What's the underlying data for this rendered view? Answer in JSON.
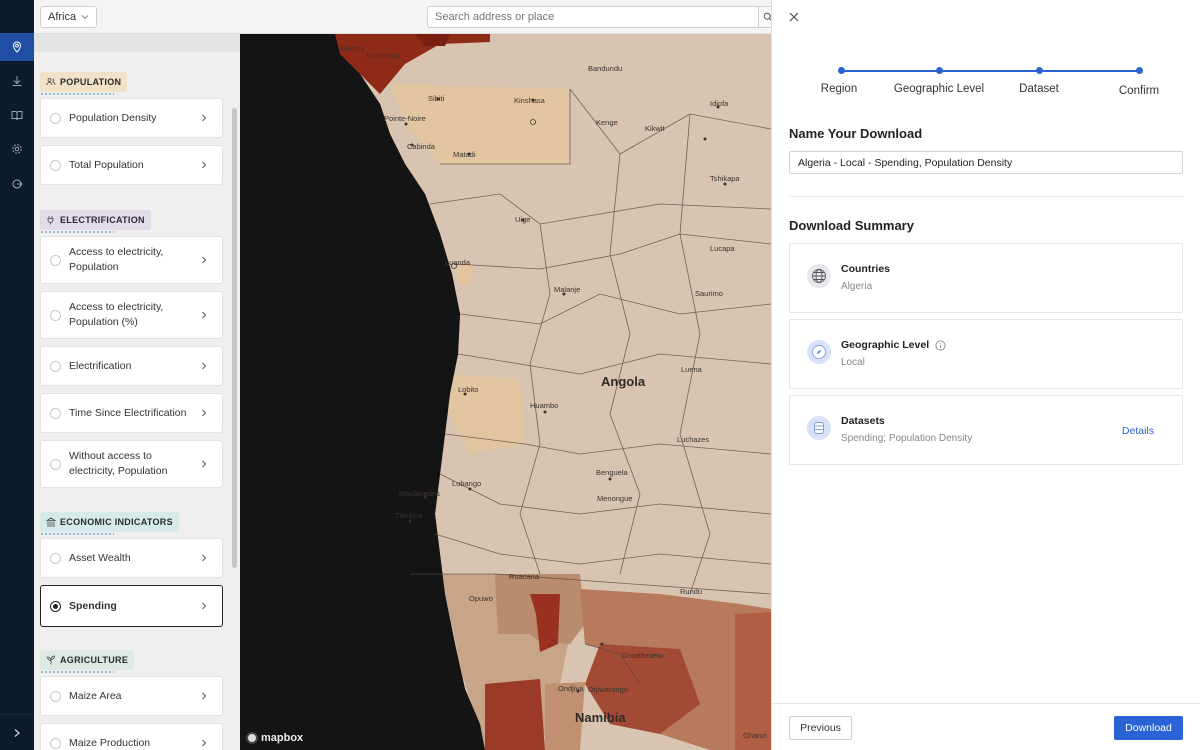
{
  "rail": {
    "items": [
      {
        "icon": "map-pin-icon",
        "active": true
      },
      {
        "icon": "download-icon",
        "active": false
      },
      {
        "icon": "book-icon",
        "active": false
      },
      {
        "icon": "gear-icon",
        "active": false
      },
      {
        "icon": "logout-icon",
        "active": false
      }
    ],
    "expand_icon": "chevron-right-icon"
  },
  "topbar": {
    "region_value": "Africa",
    "search_placeholder": "Search address or place"
  },
  "datasets": {
    "categories": [
      {
        "label": "POPULATION",
        "items": [
          "Population Density",
          "Total Population"
        ]
      },
      {
        "label": "ELECTRIFICATION",
        "items": [
          "Access to electricity, Population",
          "Access to electricity, Population (%)",
          "Electrification",
          "Time Since Electrification",
          "Without access to electricity, Population"
        ]
      },
      {
        "label": "ECONOMIC INDICATORS",
        "items": [
          "Asset Wealth",
          "Spending"
        ]
      },
      {
        "label": "AGRICULTURE",
        "items": [
          "Maize Area",
          "Maize Production"
        ]
      }
    ],
    "selected": "Spending"
  },
  "map": {
    "country_label": "Angola",
    "country_label_2": "Namibia",
    "places": [
      "Gamba",
      "Tchibanga",
      "Bandundu",
      "Sibiti",
      "Kinshasa",
      "Idiofa",
      "Pointe-Noire",
      "Kenge",
      "Kikwit",
      "Cabinda",
      "Matadi",
      "Tshikapa",
      "Uige",
      "Luanda",
      "Lucapa",
      "Malanje",
      "Saurimo",
      "Luena",
      "Lobito",
      "Huambo",
      "Luchazes",
      "Benguela",
      "Menongue",
      "Lubango",
      "Moçâmedes",
      "Tômbua",
      "Ondjiva",
      "Ruacana",
      "Opuwo",
      "Rundu",
      "Grootfontein",
      "Otjiwarongo",
      "Ghanzi"
    ],
    "attribution": "mapbox"
  },
  "drawer": {
    "steps": [
      "Region",
      "Geographic Level",
      "Dataset",
      "Confirm"
    ],
    "name_title": "Name Your Download",
    "name_value": "Algeria - Local - Spending, Population Density",
    "summary_title": "Download Summary",
    "summary": [
      {
        "title": "Countries",
        "value": "Algeria",
        "icon": "globe-icon"
      },
      {
        "title": "Geographic Level",
        "value": "Local",
        "icon": "compass-icon"
      },
      {
        "title": "Datasets",
        "value": "Spending; Population Density",
        "icon": "database-icon",
        "link": "Details"
      }
    ],
    "previous_label": "Previous",
    "download_label": "Download"
  },
  "colors": {
    "accent": "#2b63d6",
    "rail_bg": "#0d1a2c",
    "map_land": "#d8c4b0",
    "map_ocean": "#141414"
  }
}
